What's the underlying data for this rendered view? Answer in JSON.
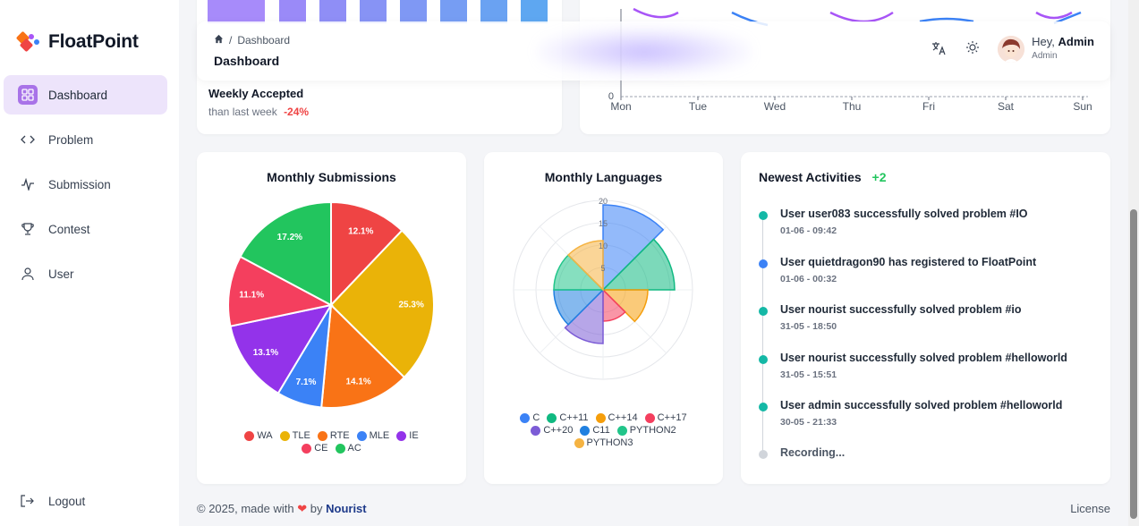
{
  "brand": {
    "name": "FloatPoint"
  },
  "sidebar": {
    "items": [
      {
        "label": "Dashboard",
        "icon": "grid-icon",
        "active": true
      },
      {
        "label": "Problem",
        "icon": "code-icon"
      },
      {
        "label": "Submission",
        "icon": "activity-icon"
      },
      {
        "label": "Contest",
        "icon": "trophy-icon"
      },
      {
        "label": "User",
        "icon": "user-icon"
      }
    ],
    "logout_label": "Logout"
  },
  "header": {
    "breadcrumb": [
      "Dashboard"
    ],
    "title": "Dashboard",
    "greeting": "Hey,",
    "user_name": "Admin",
    "user_role": "Admin"
  },
  "weekly_accepted": {
    "title": "Weekly Accepted",
    "subtitle": "than last week",
    "change": "-24%"
  },
  "weekly_chart": {
    "y_tick": "0",
    "days": [
      "Mon",
      "Tue",
      "Wed",
      "Thu",
      "Fri",
      "Sat",
      "Sun"
    ]
  },
  "monthly_submissions": {
    "title": "Monthly Submissions",
    "legend": [
      "WA",
      "TLE",
      "RTE",
      "MLE",
      "IE",
      "CE",
      "AC"
    ]
  },
  "monthly_languages": {
    "title": "Monthly Languages",
    "legend": [
      "C",
      "C++11",
      "C++14",
      "C++17",
      "C++20",
      "C11",
      "PYTHON2",
      "PYTHON3"
    ],
    "r_ticks": [
      "5",
      "10",
      "15",
      "20"
    ]
  },
  "activities": {
    "title": "Newest Activities",
    "badge": "+2",
    "items": [
      {
        "text": "User user083 successfully solved problem #IO",
        "time": "01-06 - 09:42",
        "color": "#14b8a6"
      },
      {
        "text": "User quietdragon90 has registered to FloatPoint",
        "time": "01-06 - 00:32",
        "color": "#3b82f6"
      },
      {
        "text": "User nourist successfully solved problem #io",
        "time": "31-05 - 18:50",
        "color": "#14b8a6"
      },
      {
        "text": "User nourist successfully solved problem #helloworld",
        "time": "31-05 - 15:51",
        "color": "#14b8a6"
      },
      {
        "text": "User admin successfully solved problem #helloworld",
        "time": "30-05 - 21:33",
        "color": "#14b8a6"
      }
    ],
    "recording_label": "Recording..."
  },
  "footer": {
    "copyright": "© 2025, made with",
    "by": "by",
    "author": "Nourist",
    "license": "License"
  },
  "chart_data": [
    {
      "type": "pie",
      "title": "Monthly Submissions",
      "categories": [
        "WA",
        "TLE",
        "RTE",
        "MLE",
        "IE",
        "CE",
        "AC"
      ],
      "values": [
        12.1,
        25.3,
        14.1,
        7.1,
        13.1,
        11.1,
        17.2
      ],
      "labels": [
        "12.1%",
        "25.3%",
        "14.1%",
        "7.1%",
        "13.1%",
        "11.1%",
        "17.2%"
      ],
      "colors": [
        "#ef4444",
        "#eab308",
        "#f97316",
        "#3b82f6",
        "#9333ea",
        "#f43f5e",
        "#22c55e"
      ]
    },
    {
      "type": "polar",
      "title": "Monthly Languages",
      "categories": [
        "C",
        "C++11",
        "C++14",
        "C++17",
        "C++20",
        "C11",
        "PYTHON2",
        "PYTHON3"
      ],
      "values": [
        19,
        16,
        10,
        7,
        12,
        11,
        11,
        11
      ],
      "rlim": [
        0,
        20
      ],
      "colors": [
        "#3b82f6",
        "#10b981",
        "#f59e0b",
        "#f43f5e",
        "#7c5cd6",
        "#2080e0",
        "#22c58a",
        "#f5b342"
      ]
    },
    {
      "type": "line",
      "categories": [
        "Mon",
        "Tue",
        "Wed",
        "Thu",
        "Fri",
        "Sat",
        "Sun"
      ]
    }
  ]
}
